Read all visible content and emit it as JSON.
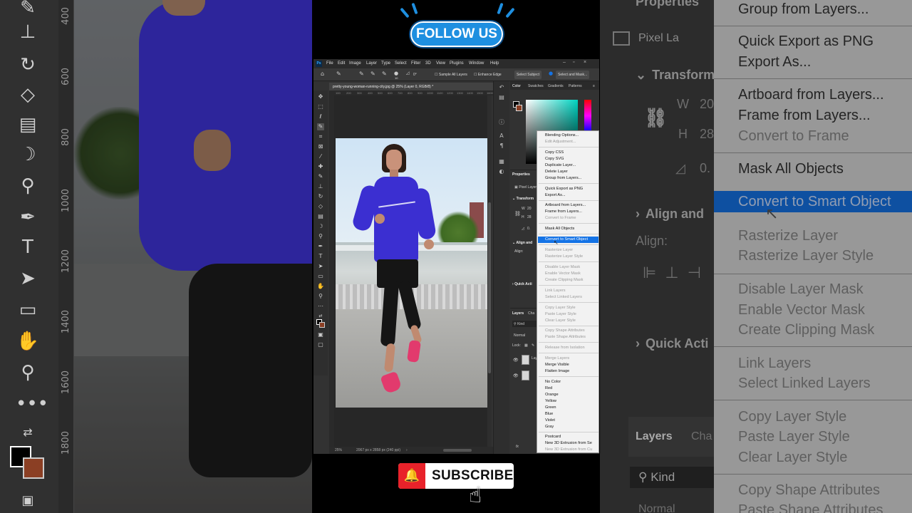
{
  "overlay": {
    "follow_label": "FOLLOW US",
    "subscribe_label": "SUBSCRIBE",
    "bell_icon": "bell-icon",
    "hand_icon": "pointer-hand-icon"
  },
  "menubar": {
    "logo": "Ps",
    "items": [
      "File",
      "Edit",
      "Image",
      "Layer",
      "Type",
      "Select",
      "Filter",
      "3D",
      "View",
      "Plugins",
      "Window",
      "Help"
    ]
  },
  "options_bar": {
    "brush_size": "10",
    "angle": "0°",
    "sample_all_layers": "Sample All Layers",
    "enhance_edge": "Enhance Edge",
    "select_subject": "Select Subject",
    "select_and_mask": "Select and Mask..."
  },
  "document": {
    "tab_title": "pretty-young-woman-running-city.jpg @ 25% (Layer 0, RGB/8) *",
    "zoom": "25%",
    "dimensions": "2067 px x 2858 px (240 ppi)",
    "ruler_marks": [
      "100",
      "200",
      "300",
      "400",
      "500",
      "600",
      "700",
      "800",
      "900",
      "1000",
      "1100",
      "1200",
      "1300",
      "1400",
      "1500",
      "1600"
    ]
  },
  "background_rulers": [
    "400",
    "600",
    "800",
    "1000",
    "1200",
    "1400",
    "1600",
    "1800"
  ],
  "right_panel": {
    "tabs": [
      "Color",
      "Swatches",
      "Gradients",
      "Patterns"
    ],
    "properties_title": "Properties",
    "pixel_layer": "Pixel Layer",
    "transform": "Transform",
    "w_label": "W",
    "h_label": "H",
    "w_value": "20",
    "h_value": "28",
    "angle_value": "0.",
    "align_title": "Align and",
    "align_label": "Align:",
    "quick_actions": "Quick Acti",
    "layers_tab": "Layers",
    "channels_tab": "Cha",
    "kind": "Kind",
    "blend_mode": "Normal",
    "lock_label": "Lock:",
    "layer_name_fragment": "Lay"
  },
  "bg_right_panel": {
    "properties": "Properties",
    "pixel_layer": "Pixel La",
    "transform": "Transform",
    "align": "Align and",
    "align_label": "Align:",
    "quick_actions": "Quick Acti",
    "layers": "Layers",
    "channels": "Cha",
    "kind": "Kind",
    "normal": "Normal",
    "w": "W",
    "h": "H",
    "w_value": "20",
    "h_value": "28",
    "angle_value": "0."
  },
  "context_menu": {
    "items": [
      {
        "label": "Blending Options...",
        "disabled": false
      },
      {
        "label": "Edit Adjustment...",
        "disabled": true
      },
      {
        "label": "Copy CSS",
        "disabled": false
      },
      {
        "label": "Copy SVG",
        "disabled": false
      },
      {
        "label": "Duplicate Layer...",
        "disabled": false
      },
      {
        "label": "Delete Layer",
        "disabled": false
      },
      {
        "label": "Group from Layers...",
        "disabled": false
      },
      {
        "label": "Quick Export as PNG",
        "disabled": false
      },
      {
        "label": "Export As...",
        "disabled": false
      },
      {
        "label": "Artboard from Layers...",
        "disabled": false
      },
      {
        "label": "Frame from Layers...",
        "disabled": false
      },
      {
        "label": "Convert to Frame",
        "disabled": true
      },
      {
        "label": "Mask All Objects",
        "disabled": false
      },
      {
        "label": "Convert to Smart Object",
        "disabled": false,
        "selected": true
      },
      {
        "label": "Rasterize Layer",
        "disabled": true
      },
      {
        "label": "Rasterize Layer Style",
        "disabled": true
      },
      {
        "label": "Disable Layer Mask",
        "disabled": true
      },
      {
        "label": "Enable Vector Mask",
        "disabled": true
      },
      {
        "label": "Create Clipping Mask",
        "disabled": true
      },
      {
        "label": "Link Layers",
        "disabled": true
      },
      {
        "label": "Select Linked Layers",
        "disabled": true
      },
      {
        "label": "Copy Layer Style",
        "disabled": true
      },
      {
        "label": "Paste Layer Style",
        "disabled": true
      },
      {
        "label": "Clear Layer Style",
        "disabled": true
      },
      {
        "label": "Copy Shape Attributes",
        "disabled": true
      },
      {
        "label": "Paste Shape Attributes",
        "disabled": true
      },
      {
        "label": "Release from Isolation",
        "disabled": true
      },
      {
        "label": "Merge Layers",
        "disabled": true
      },
      {
        "label": "Merge Visible",
        "disabled": false
      },
      {
        "label": "Flatten Image",
        "disabled": false
      },
      {
        "label": "No Color",
        "disabled": false
      },
      {
        "label": "Red",
        "disabled": false
      },
      {
        "label": "Orange",
        "disabled": false
      },
      {
        "label": "Yellow",
        "disabled": false
      },
      {
        "label": "Green",
        "disabled": false
      },
      {
        "label": "Blue",
        "disabled": false
      },
      {
        "label": "Violet",
        "disabled": false
      },
      {
        "label": "Gray",
        "disabled": false
      },
      {
        "label": "Postcard",
        "disabled": false
      },
      {
        "label": "New 3D Extrusion from Se",
        "disabled": false
      },
      {
        "label": "New 3D Extrusion from Cu",
        "disabled": true
      }
    ]
  },
  "bg_menu": {
    "items": [
      {
        "label": "Group from Layers...",
        "disabled": false
      },
      {
        "label": "Quick Export as PNG",
        "disabled": false
      },
      {
        "label": "Export As...",
        "disabled": false
      },
      {
        "label": "Artboard from Layers...",
        "disabled": false
      },
      {
        "label": "Frame from Layers...",
        "disabled": false
      },
      {
        "label": "Convert to Frame",
        "disabled": true
      },
      {
        "label": "Mask All Objects",
        "disabled": false
      },
      {
        "label": "Rasterize Layer",
        "disabled": true
      },
      {
        "label": "Rasterize Layer Style",
        "disabled": true
      },
      {
        "label": "Disable Layer Mask",
        "disabled": true
      },
      {
        "label": "Enable Vector Mask",
        "disabled": true
      },
      {
        "label": "Create Clipping Mask",
        "disabled": true
      },
      {
        "label": "Link Layers",
        "disabled": true
      },
      {
        "label": "Select Linked Layers",
        "disabled": true
      },
      {
        "label": "Copy Layer Style",
        "disabled": true
      },
      {
        "label": "Paste Layer Style",
        "disabled": true
      },
      {
        "label": "Clear Layer Style",
        "disabled": true
      },
      {
        "label": "Copy Shape Attributes",
        "disabled": true
      },
      {
        "label": "Paste Shape Attributes",
        "disabled": true
      }
    ],
    "highlighted": "Convert to Smart Object"
  },
  "colors": {
    "accent": "#1473e6",
    "follow": "#1e8fe0",
    "subscribe_red": "#e8222a",
    "foreground_swatch": "#000000",
    "background_swatch": "#8b3f24"
  }
}
